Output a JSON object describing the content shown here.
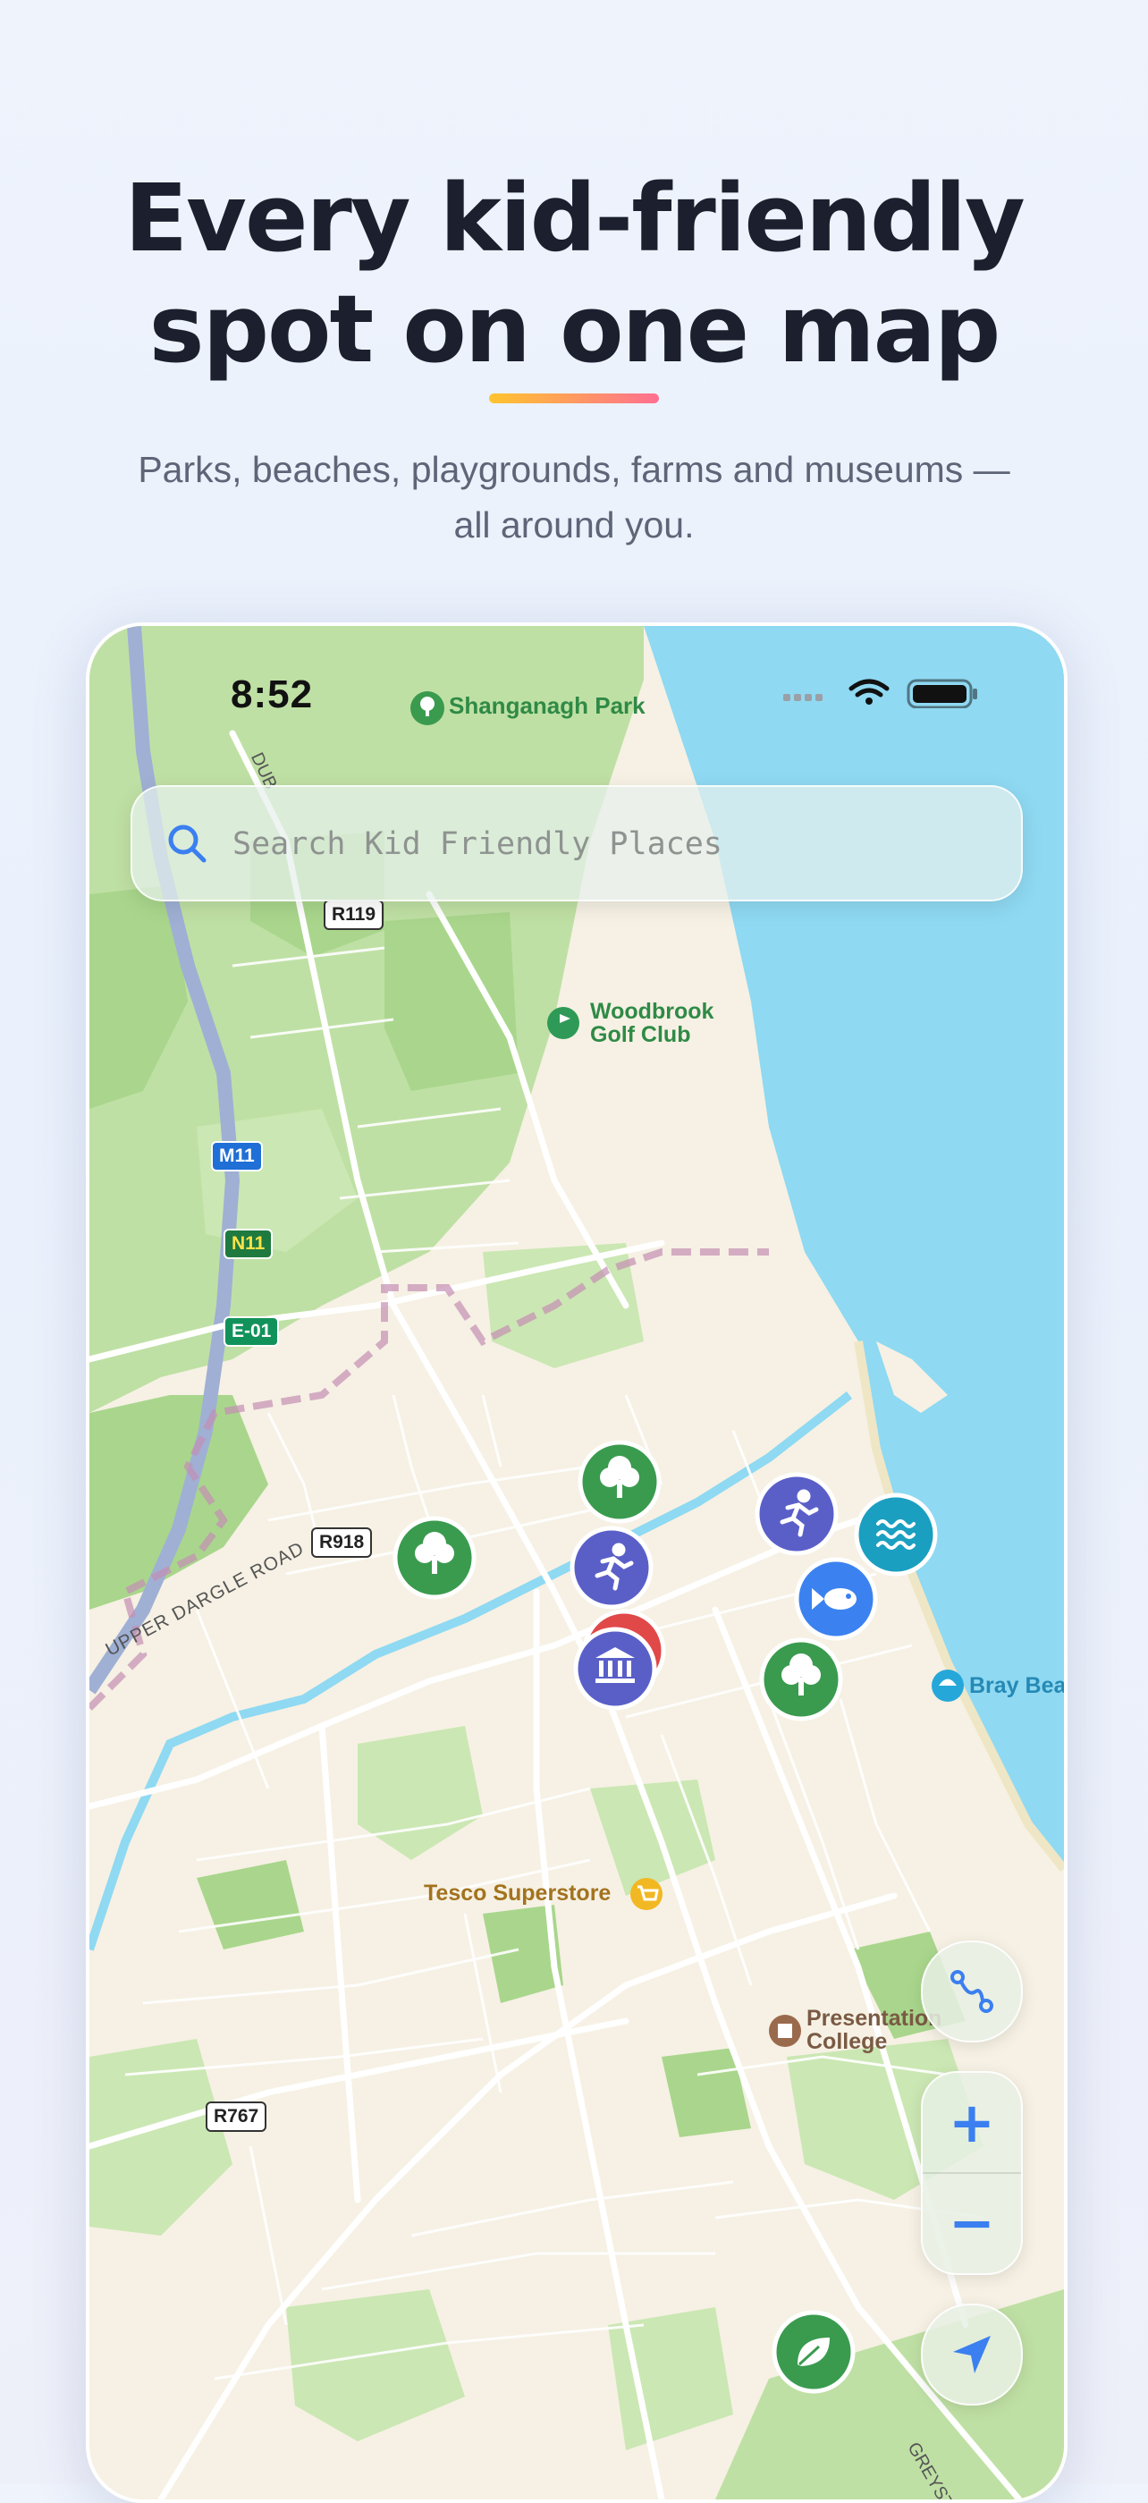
{
  "header": {
    "title_line1": "Every kid-friendly",
    "title_line2": "spot on one map",
    "subtitle_line1": "Parks, beaches, playgrounds, farms and museums —",
    "subtitle_line2": "all around you."
  },
  "status_bar": {
    "time": "8:52"
  },
  "search": {
    "placeholder": "Search Kid Friendly Places"
  },
  "map": {
    "labels": {
      "shanganagh": "Shanganagh Park",
      "woodbrook_1": "Woodbrook",
      "woodbrook_2": "Golf Club",
      "tesco": "Tesco Superstore",
      "presentation_1": "Presentation",
      "presentation_2": "College",
      "bray": "Bray Bea",
      "upper_dargle": "UPPER DARGLE ROAD",
      "greystones": "GREYSTO",
      "dub": "DUB"
    },
    "roads": {
      "r119": "R119",
      "m11": "M11",
      "n11": "N11",
      "e01": "E-01",
      "r918": "R918",
      "r767": "R767"
    },
    "pins": [
      {
        "category": "park",
        "icon": "tree-icon",
        "color": "#3a9b4f"
      },
      {
        "category": "park",
        "icon": "tree-icon",
        "color": "#3a9b4f"
      },
      {
        "category": "playground",
        "icon": "running-person-icon",
        "color": "#5a5fc8"
      },
      {
        "category": "playground",
        "icon": "running-person-icon",
        "color": "#5a5fc8"
      },
      {
        "category": "beach",
        "icon": "waves-icon",
        "color": "#1a9fc0"
      },
      {
        "category": "aquarium",
        "icon": "fish-icon",
        "color": "#3b82f0"
      },
      {
        "category": "museum",
        "icon": "museum-icon",
        "color": "#5a5fc8"
      },
      {
        "category": "park",
        "icon": "tree-icon",
        "color": "#3a9b4f"
      },
      {
        "category": "nature",
        "icon": "leaf-icon",
        "color": "#3a9b4f"
      }
    ]
  },
  "controls": {
    "route": "route-icon",
    "zoom_in": "+",
    "zoom_out": "−",
    "locate": "location-arrow-icon"
  },
  "colors": {
    "accent": "#3b7ff0",
    "park": "#3a9b4f",
    "activity": "#5a5fc8",
    "water": "#8fd9f2"
  }
}
